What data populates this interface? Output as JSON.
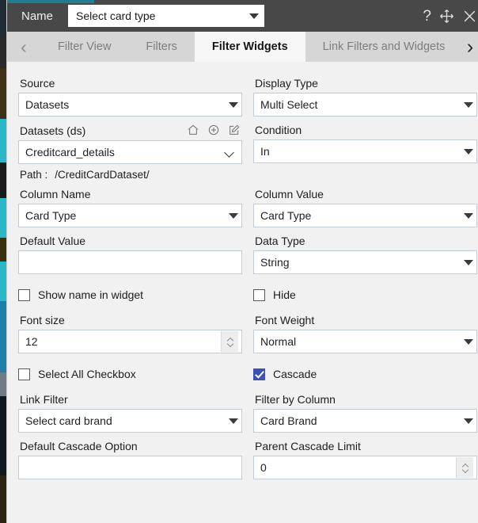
{
  "titlebar": {
    "name_label": "Name",
    "name_value": "Select card type",
    "help_icon": "question-mark-icon",
    "move_icon": "move-icon",
    "close_icon": "close-icon"
  },
  "tabs": {
    "prev_arrow": "‹",
    "next_arrow": "›",
    "items": [
      {
        "label": "Filter View",
        "active": false
      },
      {
        "label": "Filters",
        "active": false
      },
      {
        "label": "Filter Widgets",
        "active": true
      },
      {
        "label": "Link Filters and Widgets",
        "active": false
      }
    ]
  },
  "form": {
    "source": {
      "label": "Source",
      "value": "Datasets"
    },
    "display_type": {
      "label": "Display Type",
      "value": "Multi Select"
    },
    "datasets": {
      "label": "Datasets (ds)",
      "value": "Creditcard_details",
      "icons": [
        "home-icon",
        "plus-circle-icon",
        "edit-icon"
      ],
      "path_label": "Path :",
      "path_value": "/CreditCardDataset/"
    },
    "condition": {
      "label": "Condition",
      "value": "In"
    },
    "column_name": {
      "label": "Column Name",
      "value": "Card Type"
    },
    "column_value": {
      "label": "Column Value",
      "value": "Card Type"
    },
    "default_value": {
      "label": "Default Value",
      "value": ""
    },
    "data_type": {
      "label": "Data Type",
      "value": "String"
    },
    "show_name_in_widget": {
      "label": "Show name in widget",
      "checked": false
    },
    "hide": {
      "label": "Hide",
      "checked": false
    },
    "font_size": {
      "label": "Font size",
      "value": "12"
    },
    "font_weight": {
      "label": "Font Weight",
      "value": "Normal"
    },
    "select_all_checkbox": {
      "label": "Select All Checkbox",
      "checked": false
    },
    "cascade": {
      "label": "Cascade",
      "checked": true
    },
    "link_filter": {
      "label": "Link Filter",
      "value": "Select card brand"
    },
    "filter_by_column": {
      "label": "Filter by Column",
      "value": "Card Brand"
    },
    "default_cascade_option": {
      "label": "Default Cascade Option",
      "value": ""
    },
    "parent_cascade_limit": {
      "label": "Parent Cascade Limit",
      "value": "0"
    }
  },
  "colors": {
    "titlebar": "#484848",
    "accent": "#1f7e93",
    "tabstrip": "#d6d6d6",
    "active_tab": "#f7f7f7",
    "panel": "#f1f1f1",
    "checkbox_checked": "#3b53b5",
    "field_border": "#c3cbd6"
  }
}
